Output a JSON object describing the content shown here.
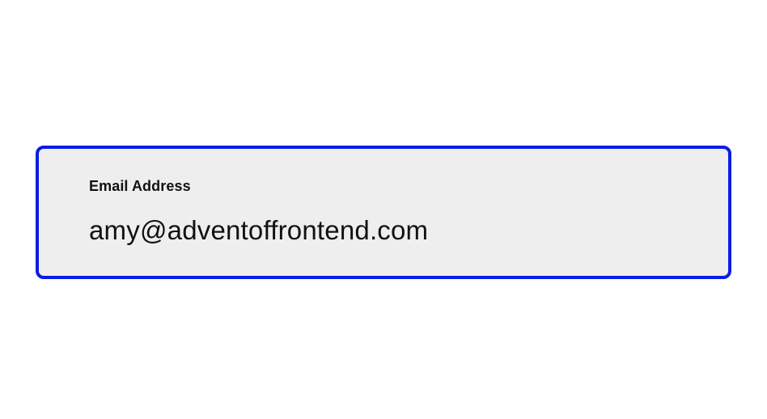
{
  "email_field": {
    "label": "Email Address",
    "value": "amy@adventoffrontend.com"
  },
  "colors": {
    "border": "#0a1de6",
    "background": "#eeeeee",
    "text": "#111111"
  }
}
